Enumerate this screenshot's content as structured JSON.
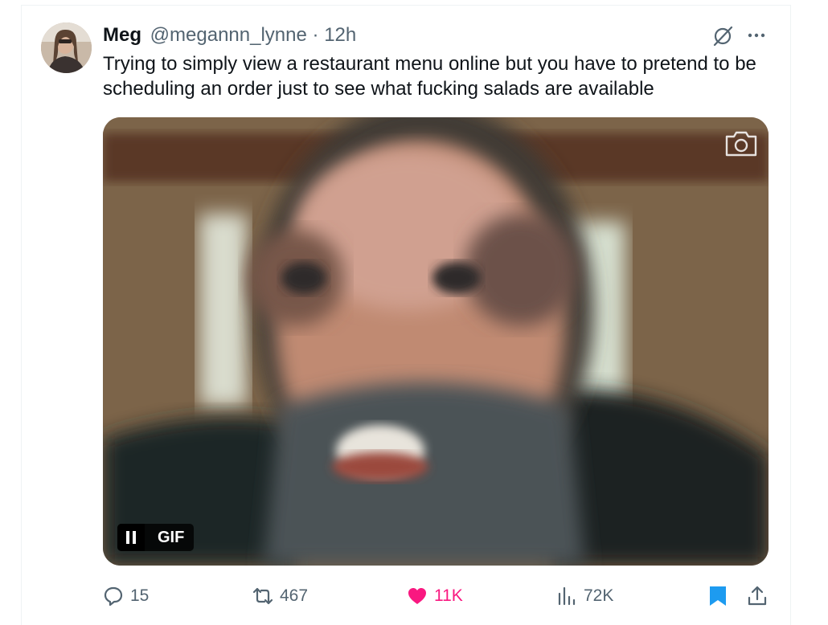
{
  "tweet": {
    "author_name": "Meg",
    "author_handle": "@megannn_lynne",
    "separator": "·",
    "timestamp": "12h",
    "text": "Trying to simply view a restaurant menu online but you have to pretend to be scheduling an order just to see what fucking salads are available"
  },
  "media": {
    "badge_label": "GIF",
    "icons": [
      "camera-icon",
      "pause-icon"
    ]
  },
  "actions": {
    "replies": "15",
    "reposts": "467",
    "likes": "11K",
    "views": "72K"
  },
  "icons": {
    "header": [
      "grok-icon",
      "more-icon"
    ],
    "actions": [
      "reply-icon",
      "repost-icon",
      "like-icon",
      "views-icon",
      "bookmark-icon",
      "share-icon"
    ]
  },
  "colors": {
    "text_primary": "#0f1419",
    "text_secondary": "#536471",
    "like_pink": "#f91880",
    "bookmark_blue": "#1d9bf0"
  }
}
